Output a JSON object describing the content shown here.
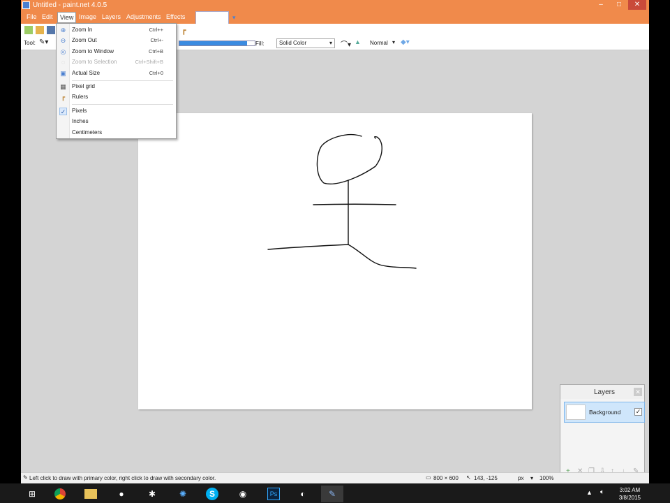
{
  "window": {
    "title": "Untitled - paint.net 4.0.5"
  },
  "menubar": {
    "items": [
      {
        "label": "File"
      },
      {
        "label": "Edit"
      },
      {
        "label": "View"
      },
      {
        "label": "Image"
      },
      {
        "label": "Layers"
      },
      {
        "label": "Adjustments"
      },
      {
        "label": "Effects"
      }
    ]
  },
  "toolbar": {
    "tool_label": "Tool:",
    "fill_label": "Fill:",
    "fill_value": "Solid Color",
    "blend_value": "Normal",
    "progress_fraction": 0.9
  },
  "view_menu": {
    "items": [
      {
        "label": "Zoom In",
        "shortcut": "Ctrl++",
        "icon": "zoom-in-icon"
      },
      {
        "label": "Zoom Out",
        "shortcut": "Ctrl+-",
        "icon": "zoom-out-icon"
      },
      {
        "label": "Zoom to Window",
        "shortcut": "Ctrl+B",
        "icon": "zoom-window-icon"
      },
      {
        "label": "Zoom to Selection",
        "shortcut": "Ctrl+Shift+B",
        "icon": "zoom-selection-icon",
        "disabled": true
      },
      {
        "label": "Actual Size",
        "shortcut": "Ctrl+0",
        "icon": "actual-size-icon"
      },
      {
        "label": "Pixel grid",
        "shortcut": "",
        "icon": "grid-icon"
      },
      {
        "label": "Rulers",
        "shortcut": "",
        "icon": "ruler-icon"
      },
      {
        "label": "Pixels",
        "shortcut": "",
        "icon": "check-icon",
        "checked": true
      },
      {
        "label": "Inches",
        "shortcut": ""
      },
      {
        "label": "Centimeters",
        "shortcut": ""
      }
    ]
  },
  "layers_panel": {
    "title": "Layers",
    "layers": [
      {
        "name": "Background",
        "visible": true
      }
    ]
  },
  "statusbar": {
    "hint": "Left click to draw with primary color, right click to draw with secondary color.",
    "image_size": "800 × 600",
    "cursor_pos": "143, -125",
    "units": "px",
    "zoom": "100%"
  },
  "taskbar": {
    "time": "3:02 AM",
    "date": "3/8/2015"
  },
  "colors": {
    "accent": "#f08a4b",
    "selection": "#cfe6fb"
  }
}
